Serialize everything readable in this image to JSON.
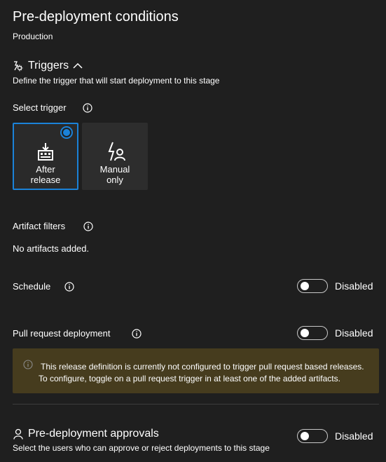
{
  "header": {
    "title": "Pre-deployment conditions",
    "stage": "Production"
  },
  "triggers": {
    "title": "Triggers",
    "icon": "triggers-icon",
    "collapse_icon": "chevron-up-icon",
    "description": "Define the trigger that will start deployment to this stage",
    "select_label": "Select trigger",
    "options": [
      {
        "label_line1": "After",
        "label_line2": "release",
        "icon": "release-icon",
        "selected": true
      },
      {
        "label_line1": "Manual",
        "label_line2": "only",
        "icon": "manual-lightning-user-icon",
        "selected": false
      }
    ]
  },
  "artifact_filters": {
    "label": "Artifact filters",
    "empty_text": "No artifacts added."
  },
  "schedule": {
    "label": "Schedule",
    "toggle_state": "Disabled"
  },
  "pull_request": {
    "label": "Pull request deployment",
    "toggle_state": "Disabled",
    "warning_line1": "This release definition is currently not configured to trigger pull request based releases.",
    "warning_line2": "To configure, toggle on a pull request trigger in at least one of the added artifacts."
  },
  "approvals": {
    "title": "Pre-deployment approvals",
    "icon": "person-icon",
    "description": "Select the users who can approve or reject deployments to this stage",
    "toggle_state": "Disabled"
  },
  "colors": {
    "background": "#1f1f1f",
    "accent": "#1b82d8",
    "warning_bg": "#463c1e"
  }
}
